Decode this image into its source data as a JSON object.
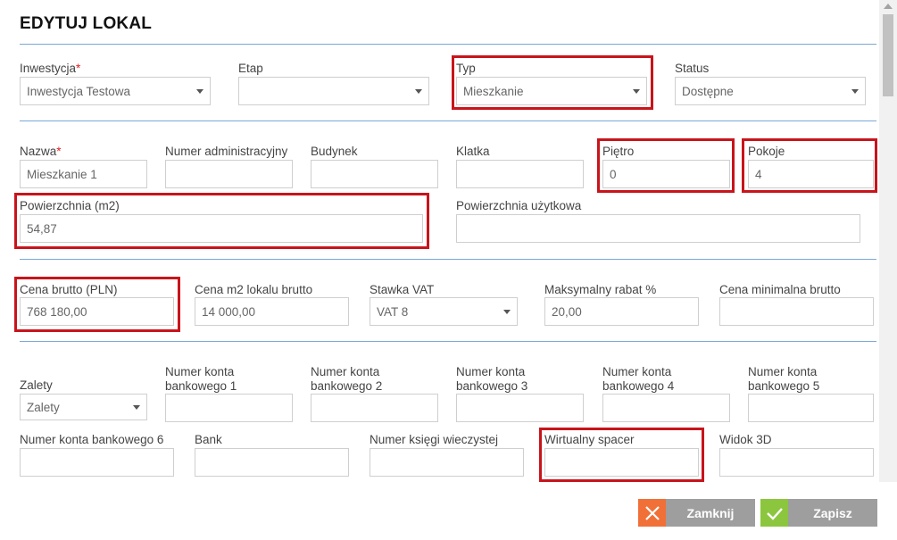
{
  "title": "EDYTUJ LOKAL",
  "section1": {
    "investment": {
      "label": "Inwestycja",
      "value": "Inwestycja Testowa"
    },
    "stage": {
      "label": "Etap",
      "value": ""
    },
    "type": {
      "label": "Typ",
      "value": "Mieszkanie"
    },
    "status": {
      "label": "Status",
      "value": "Dostępne"
    }
  },
  "section2": {
    "name": {
      "label": "Nazwa",
      "value": "Mieszkanie 1"
    },
    "admin_number": {
      "label": "Numer administracyjny",
      "value": ""
    },
    "building": {
      "label": "Budynek",
      "value": ""
    },
    "staircase": {
      "label": "Klatka",
      "value": ""
    },
    "floor": {
      "label": "Piętro",
      "value": "0"
    },
    "rooms": {
      "label": "Pokoje",
      "value": "4"
    },
    "area": {
      "label": "Powierzchnia (m2)",
      "value": "54,87"
    },
    "usable_area": {
      "label": "Powierzchnia użytkowa",
      "value": ""
    }
  },
  "section3": {
    "gross_price": {
      "label": "Cena brutto (PLN)",
      "value": "768 180,00"
    },
    "price_m2": {
      "label": "Cena m2 lokalu brutto",
      "value": "14 000,00"
    },
    "vat_rate": {
      "label": "Stawka VAT",
      "value": "VAT 8"
    },
    "max_discount": {
      "label": "Maksymalny rabat %",
      "value": "20,00"
    },
    "min_gross_price": {
      "label": "Cena minimalna brutto",
      "value": ""
    }
  },
  "section4": {
    "advantages": {
      "label": "Zalety",
      "value": "Zalety"
    },
    "bank_account_1": {
      "label": "Numer konta bankowego 1",
      "value": ""
    },
    "bank_account_2": {
      "label": "Numer konta bankowego 2",
      "value": ""
    },
    "bank_account_3": {
      "label": "Numer konta bankowego 3",
      "value": ""
    },
    "bank_account_4": {
      "label": "Numer konta bankowego 4",
      "value": ""
    },
    "bank_account_5": {
      "label": "Numer konta bankowego 5",
      "value": ""
    },
    "bank_account_6": {
      "label": "Numer konta bankowego 6",
      "value": ""
    },
    "bank": {
      "label": "Bank",
      "value": ""
    },
    "land_register": {
      "label": "Numer księgi wieczystej",
      "value": ""
    },
    "virtual_tour": {
      "label": "Wirtualny spacer",
      "value": ""
    },
    "view_3d": {
      "label": "Widok 3D",
      "value": ""
    }
  },
  "buttons": {
    "close": "Zamknij",
    "save": "Zapisz"
  },
  "required_marker": "*",
  "colors": {
    "accent_line": "#7aa9d6",
    "highlight": "#c8141b",
    "required": "#e02020",
    "close_icon_bg": "#f07038",
    "save_icon_bg": "#8cc63e",
    "button_bg": "#9e9e9e"
  }
}
